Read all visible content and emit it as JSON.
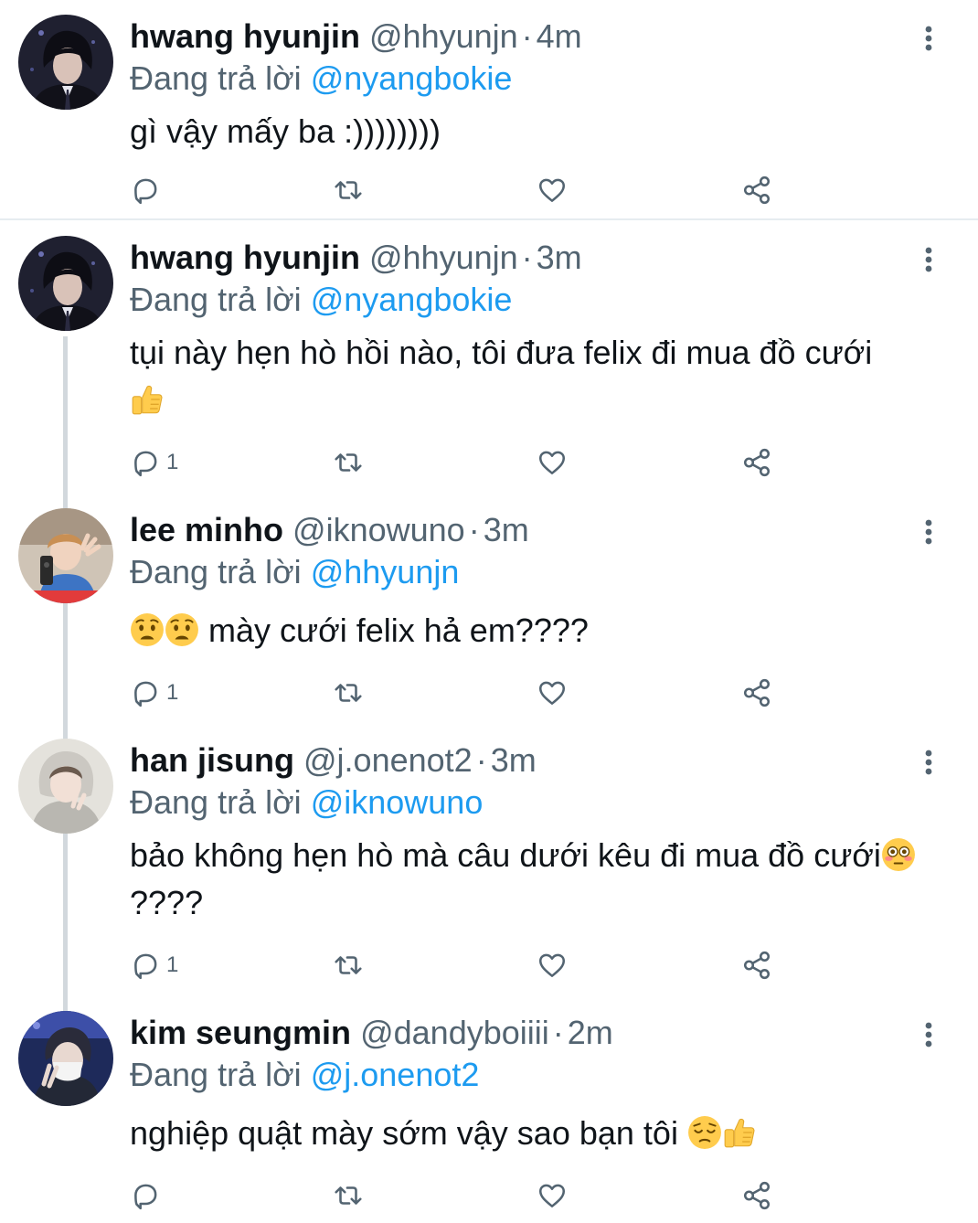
{
  "reply_prefix": "Đang trả lời",
  "colors": {
    "link": "#1d9bf0",
    "secondary_text": "#536471",
    "thread_line": "#d2d8dd"
  },
  "tweets": [
    {
      "name": "hwang hyunjin",
      "handle": "@hhyunjn",
      "time": "4m",
      "replying_to": "@nyangbokie",
      "text": "gì vậy mấy ba :))))))))",
      "reply_count": ""
    },
    {
      "name": "hwang hyunjin",
      "handle": "@hhyunjn",
      "time": "3m",
      "replying_to": "@nyangbokie",
      "text": "tụi này hẹn hò hồi nào, tôi đưa felix đi mua đồ cưới",
      "emoji": "thumbs-up",
      "reply_count": "1"
    },
    {
      "name": "lee minho",
      "handle": "@iknowuno",
      "time": "3m",
      "replying_to": "@hhyunjn",
      "text": "mày cưới felix hả em????",
      "emoji": "worried-face x2",
      "reply_count": "1"
    },
    {
      "name": "han jisung",
      "handle": "@j.onenot2",
      "time": "3m",
      "replying_to": "@iknowuno",
      "text_a": "bảo không hẹn hò mà câu dưới kêu đi mua đồ cưới",
      "text_b": "????",
      "emoji": "flushed-face",
      "reply_count": "1"
    },
    {
      "name": "kim seungmin",
      "handle": "@dandyboiiii",
      "time": "2m",
      "replying_to": "@j.onenot2",
      "text": "nghiệp quật mày sớm vậy sao bạn tôi",
      "emoji": "pensive-face, thumbs-up",
      "reply_count": ""
    }
  ]
}
